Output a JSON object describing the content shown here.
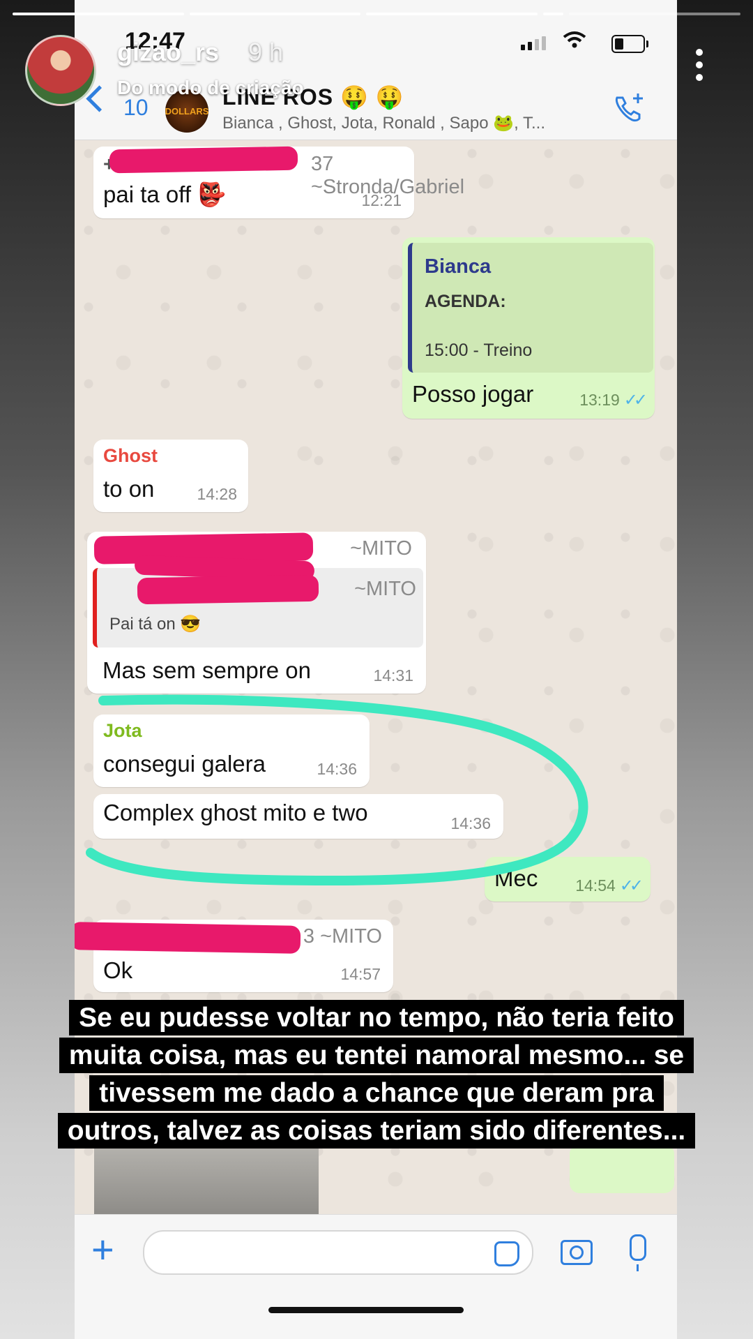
{
  "story": {
    "username": "gizao_rs",
    "age": "9 h",
    "subtitle": "Do modo de criação",
    "caption": "Se eu pudesse voltar no tempo, não teria feito muita coisa, mas eu tentei namoral mesmo... se tivessem me dado a chance que deram pra outros, talvez as coisas teriam sido diferentes..."
  },
  "status_bar": {
    "time": "12:47"
  },
  "header": {
    "back_count": "10",
    "group_avatar_text": "DOLLARS",
    "group_name": "LINE ROS 🤑 🤑",
    "members": "Bianca , Ghost, Jota, Ronald , Sapo 🐸, T..."
  },
  "messages": {
    "m1": {
      "phone": "37 ~Stronda/Gabriel",
      "text": "pai ta off 👺",
      "time": "12:21"
    },
    "m2": {
      "quote_name": "Bianca",
      "quote_line1": "AGENDA:",
      "quote_line2": "15:00 - Treino",
      "text": "Posso jogar",
      "time": "13:19",
      "ticks": "✓✓"
    },
    "m3": {
      "sender": "Ghost",
      "text": "to on",
      "time": "14:28"
    },
    "m4": {
      "phone": "~MITO",
      "quote_phone": "~MITO",
      "quote_text": "Pai tá on 😎",
      "text": "Mas sem sempre on",
      "time": "14:31"
    },
    "m5": {
      "sender": "Jota",
      "text": "consegui galera",
      "time": "14:36"
    },
    "m6": {
      "text": "Complex ghost mito e two",
      "time": "14:36"
    },
    "m7": {
      "text": "Mec",
      "time": "14:54",
      "ticks": "✓✓"
    },
    "m8": {
      "phone": "3 ~MITO",
      "text": "Ok",
      "time": "14:57"
    }
  },
  "colors": {
    "ghost": "#e8493f",
    "jota": "#7fba1f",
    "bianca": "#2d3a8c",
    "mito_quote_bar": "#e0201e",
    "accent": "#2f7fde",
    "highlight": "#3ee8c0",
    "redaction": "#e8196b"
  },
  "icons": [
    "back-chevron-icon",
    "add-call-icon",
    "plus-icon",
    "sticker-icon",
    "camera-icon",
    "mic-icon",
    "more-icon"
  ]
}
